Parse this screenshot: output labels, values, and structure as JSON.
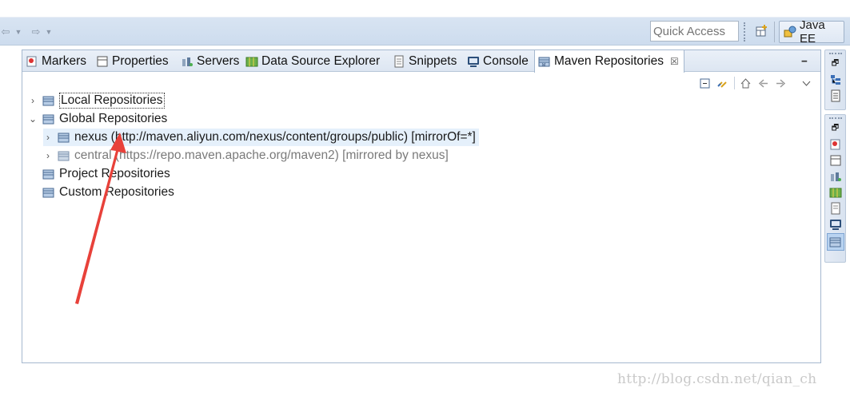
{
  "toolbar": {
    "nav_icons": [
      "back-arrow-icon",
      "dropdown-icon",
      "forward-arrow-icon",
      "dropdown-icon"
    ],
    "quick_access_placeholder": "Quick Access",
    "perspective_label": "Java EE"
  },
  "tabs": [
    {
      "label": "Markers",
      "icon": "markers-icon"
    },
    {
      "label": "Properties",
      "icon": "properties-icon"
    },
    {
      "label": "Servers",
      "icon": "servers-icon"
    },
    {
      "label": "Data Source Explorer",
      "icon": "data-source-icon"
    },
    {
      "label": "Snippets",
      "icon": "snippets-icon"
    },
    {
      "label": "Console",
      "icon": "console-icon"
    },
    {
      "label": "Maven Repositories",
      "icon": "maven-repo-icon",
      "active": true,
      "close": "☒"
    }
  ],
  "tree": {
    "local": "Local Repositories",
    "global": "Global Repositories",
    "nexus": "nexus (http://maven.aliyun.com/nexus/content/groups/public) [mirrorOf=*]",
    "central": "central (https://repo.maven.apache.org/maven2) [mirrored by nexus]",
    "project": "Project Repositories",
    "custom": "Custom Repositories"
  },
  "colors": {
    "accent": "#3b6fb6",
    "annotation_arrow": "#e8413a",
    "selection": "#e5f0fb"
  },
  "watermark": "http://blog.csdn.net/qian_ch"
}
